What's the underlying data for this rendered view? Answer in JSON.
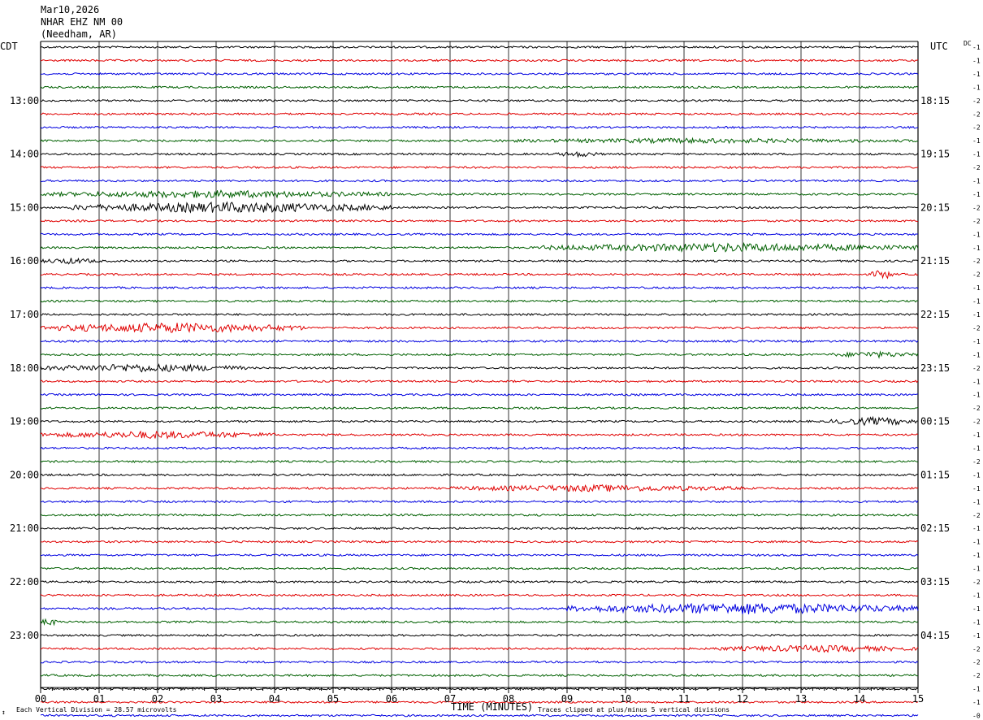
{
  "header": {
    "date": "Mar10,2026",
    "station": "NHAR EHZ NM 00",
    "location": "(Needham, AR)"
  },
  "left_axis_label": "CDT",
  "right_axis_label": "UTC",
  "dc_label": "DC",
  "footer": {
    "scale_note": "Each Vertical Division =   28.57 microvolts",
    "scale_mark": "↕",
    "clip_note": "Traces clipped at plus/minus 5 vertical divisions"
  },
  "chart_data": {
    "type": "line",
    "title": "",
    "xlabel": "TIME (MINUTES)",
    "ylabel": "",
    "xlim": [
      0,
      15
    ],
    "x_ticks": [
      "00",
      "01",
      "02",
      "03",
      "04",
      "05",
      "06",
      "07",
      "08",
      "09",
      "10",
      "11",
      "12",
      "13",
      "14",
      "15"
    ],
    "grid": true,
    "trace_interval_minutes": 15,
    "trace_colors": [
      "#000000",
      "#e00000",
      "#0000e0",
      "#006000"
    ],
    "left_hour_labels": [
      "13:00",
      "14:00",
      "15:00",
      "16:00",
      "17:00",
      "18:00",
      "19:00",
      "20:00",
      "21:00",
      "22:00",
      "23:00"
    ],
    "right_hour_labels": [
      "18:15",
      "19:15",
      "20:15",
      "21:15",
      "22:15",
      "23:15",
      "00:15",
      "01:15",
      "02:15",
      "03:15",
      "04:15"
    ],
    "dc_offsets": [
      -1,
      -1,
      -1,
      -1,
      -2,
      -2,
      -2,
      -1,
      -1,
      -2,
      -1,
      -1,
      -2,
      -2,
      -1,
      -1,
      -2,
      -2,
      -1,
      -1,
      -1,
      -2,
      -1,
      -1,
      -2,
      -1,
      -1,
      -2,
      -2,
      -1,
      -1,
      -2,
      -1,
      -1,
      -1,
      -2,
      -1,
      -1,
      -1,
      -1,
      -2,
      -1,
      -1,
      -1,
      -1,
      -2,
      -2,
      -2,
      -1,
      -1,
      0,
      -1
    ],
    "events": [
      {
        "trace": 7,
        "start": 7.5,
        "end": 15.0,
        "amp": 1.6
      },
      {
        "trace": 8,
        "start": 8.8,
        "end": 9.6,
        "amp": 1.8
      },
      {
        "trace": 11,
        "start": 0.0,
        "end": 6.0,
        "amp": 2.4
      },
      {
        "trace": 12,
        "start": 0.5,
        "end": 6.0,
        "amp": 3.4
      },
      {
        "trace": 15,
        "start": 8.5,
        "end": 15.0,
        "amp": 2.8
      },
      {
        "trace": 16,
        "start": 0.0,
        "end": 1.0,
        "amp": 2.0
      },
      {
        "trace": 17,
        "start": 14.2,
        "end": 14.6,
        "amp": 3.0
      },
      {
        "trace": 21,
        "start": 0.0,
        "end": 4.5,
        "amp": 3.2
      },
      {
        "trace": 23,
        "start": 13.5,
        "end": 15.0,
        "amp": 2.0
      },
      {
        "trace": 24,
        "start": 0.0,
        "end": 3.5,
        "amp": 2.6
      },
      {
        "trace": 28,
        "start": 13.5,
        "end": 15.0,
        "amp": 2.6
      },
      {
        "trace": 29,
        "start": 0.0,
        "end": 4.0,
        "amp": 2.4
      },
      {
        "trace": 33,
        "start": 7.0,
        "end": 12.0,
        "amp": 2.2
      },
      {
        "trace": 42,
        "start": 9.0,
        "end": 15.0,
        "amp": 3.6
      },
      {
        "trace": 43,
        "start": 0.0,
        "end": 0.3,
        "amp": 2.5
      },
      {
        "trace": 45,
        "start": 11.5,
        "end": 15.0,
        "amp": 2.2
      }
    ]
  }
}
